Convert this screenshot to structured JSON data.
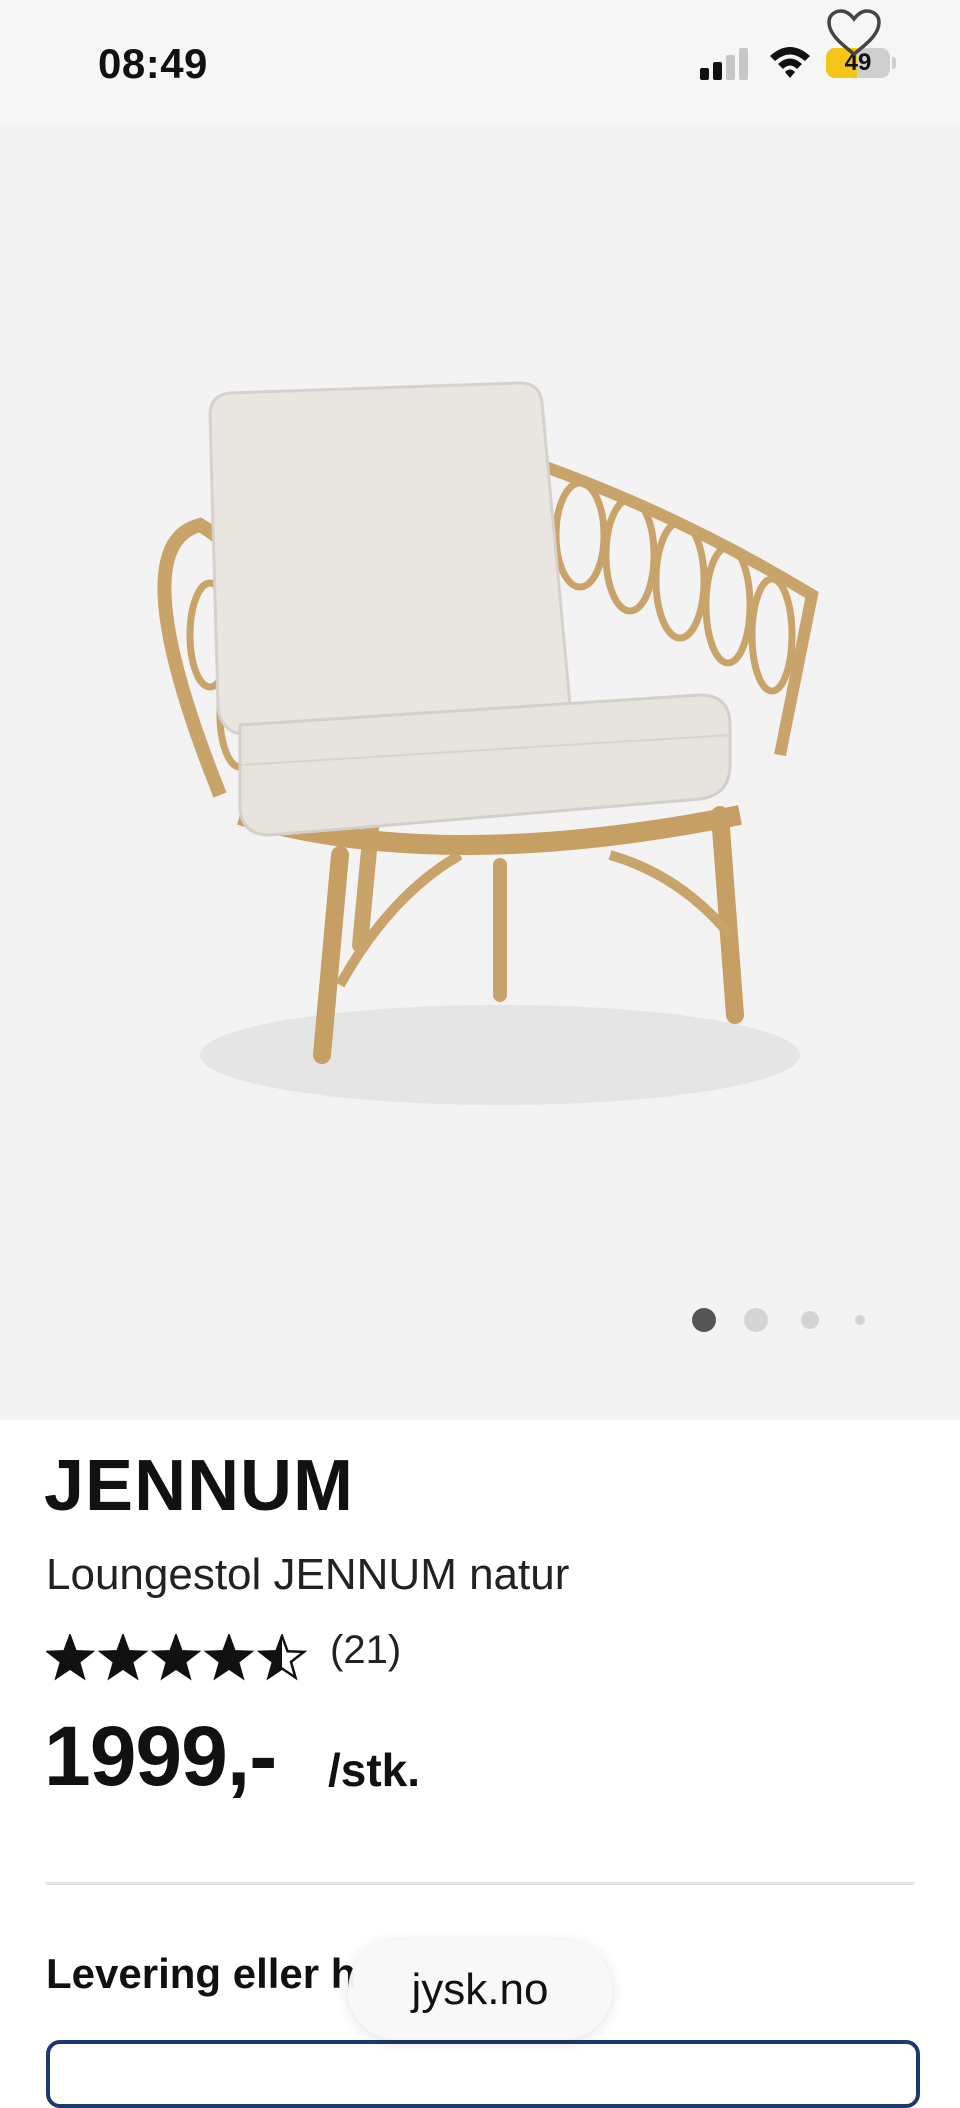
{
  "status_bar": {
    "time": "08:49",
    "battery_level": "49",
    "battery_fraction": 0.49
  },
  "gallery": {
    "image_description_icon": "rattan-lounge-chair-image",
    "page_count": 4,
    "active_page": 1
  },
  "product": {
    "brand": "JENNUM",
    "name": "Loungestol JENNUM natur",
    "rating_stars": 4.5,
    "review_count": "(21)",
    "price": "1999,-",
    "unit": "/stk."
  },
  "delivery": {
    "heading": "Levering eller h"
  },
  "browser": {
    "url": "jysk.no"
  },
  "colors": {
    "accent": "#1c3a6e",
    "battery": "#f5c518",
    "gallery_bg": "#f4f3f3"
  }
}
